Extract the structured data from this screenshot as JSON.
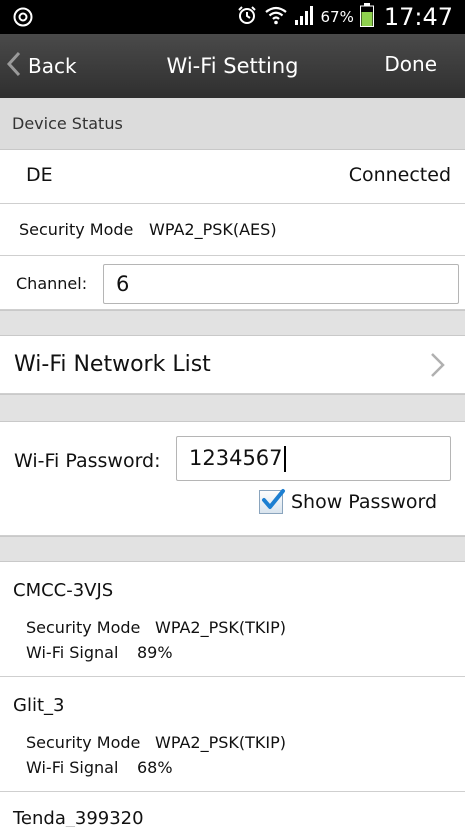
{
  "status_bar": {
    "battery_percent": "67%",
    "time": "17:47",
    "icons": [
      "settings-gear-icon",
      "alarm-clock-icon",
      "wifi-icon",
      "cell-signal-icon",
      "battery-icon"
    ]
  },
  "navbar": {
    "back_label": "Back",
    "title": "Wi-Fi Setting",
    "done_label": "Done"
  },
  "device_status": {
    "header": "Device Status",
    "device_name": "DE",
    "connection_status": "Connected",
    "security_mode_label": "Security Mode",
    "security_mode_value": "WPA2_PSK(AES)",
    "channel_label": "Channel:",
    "channel_value": "6"
  },
  "wifi_list": {
    "label": "Wi-Fi Network List"
  },
  "password": {
    "label": "Wi-Fi Password:",
    "value": "1234567",
    "show_password_label": "Show Password",
    "show_password_checked": true
  },
  "networks": [
    {
      "name": "CMCC-3VJS",
      "security_label": "Security Mode",
      "security_value": "WPA2_PSK(TKIP)",
      "signal_label": "Wi-Fi Signal",
      "signal_value": "89%"
    },
    {
      "name": "Glit_3",
      "security_label": "Security Mode",
      "security_value": "WPA2_PSK(TKIP)",
      "signal_label": "Wi-Fi Signal",
      "signal_value": "68%"
    },
    {
      "name": "Tenda_399320"
    }
  ],
  "colors": {
    "navbar": "#3a3a3a",
    "section_band": "#e2e2e2",
    "checkbox_check": "#1d7fd1"
  }
}
